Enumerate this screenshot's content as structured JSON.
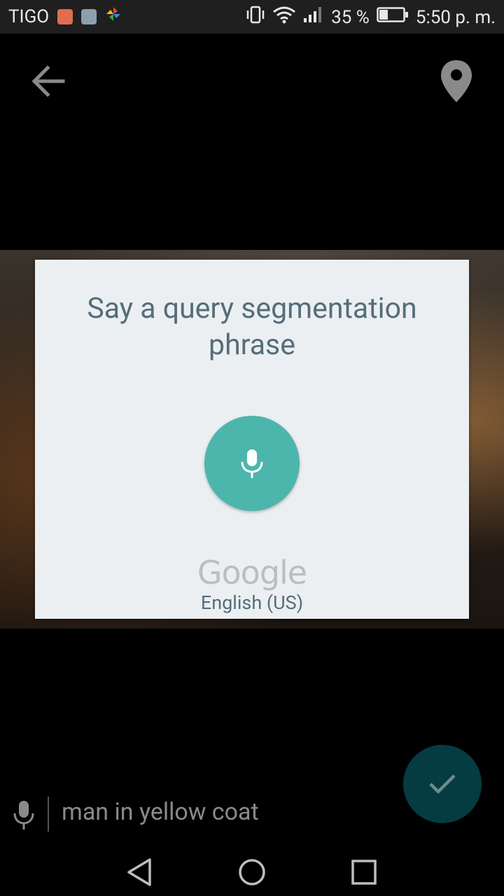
{
  "status_bar": {
    "carrier": "TIGO",
    "battery_percent": "35 %",
    "time": "5:50 p. m.",
    "battery_level": 0.35
  },
  "toolbar": {
    "back_icon": "arrow-back-icon",
    "location_icon": "location-pin-icon"
  },
  "dialog": {
    "title": "Say a query segmentation phrase",
    "mic_icon": "microphone-icon",
    "brand": "Google",
    "language": "English (US)",
    "accent_color": "#4db6ac"
  },
  "query_input": {
    "value": "man in yellow coat",
    "mic_icon": "microphone-icon"
  },
  "fab": {
    "icon": "check-icon",
    "color": "#043c42"
  },
  "nav_bar": {
    "back_icon": "nav-back-icon",
    "home_icon": "nav-home-icon",
    "recents_icon": "nav-recents-icon"
  }
}
